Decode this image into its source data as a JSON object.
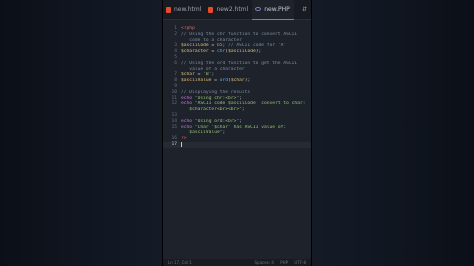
{
  "tabs": [
    {
      "label": "new.html",
      "icon": "html-file-icon",
      "active": false
    },
    {
      "label": "new2.html",
      "icon": "html-file-icon",
      "active": false
    },
    {
      "label": "new.PHP",
      "icon": "php-file-icon",
      "active": true
    }
  ],
  "tab_actions_label": "⇵",
  "code_lines": [
    {
      "num": "1",
      "tokens": [
        {
          "t": "tag",
          "v": "<?php"
        }
      ]
    },
    {
      "num": "2",
      "tokens": [
        {
          "t": "comment",
          "v": "// Using the chr function to convert ASCII"
        }
      ]
    },
    {
      "num": "",
      "tokens": [
        {
          "t": "comment",
          "v": "   code to a character"
        }
      ]
    },
    {
      "num": "3",
      "tokens": [
        {
          "t": "var",
          "v": "$asciiCode"
        },
        {
          "t": "plain",
          "v": " = "
        },
        {
          "t": "num",
          "v": "65"
        },
        {
          "t": "plain",
          "v": "; "
        },
        {
          "t": "comment",
          "v": "// ASCII code for 'A'"
        }
      ]
    },
    {
      "num": "4",
      "tokens": [
        {
          "t": "var",
          "v": "$character"
        },
        {
          "t": "plain",
          "v": " = "
        },
        {
          "t": "fn",
          "v": "chr"
        },
        {
          "t": "plain",
          "v": "("
        },
        {
          "t": "var",
          "v": "$asciiCode"
        },
        {
          "t": "plain",
          "v": ");"
        }
      ]
    },
    {
      "num": "5",
      "tokens": []
    },
    {
      "num": "6",
      "tokens": [
        {
          "t": "comment",
          "v": "// Using the ord function to get the ASCII"
        }
      ]
    },
    {
      "num": "",
      "tokens": [
        {
          "t": "comment",
          "v": "   value of a character"
        }
      ]
    },
    {
      "num": "7",
      "tokens": [
        {
          "t": "var",
          "v": "$char"
        },
        {
          "t": "plain",
          "v": " = "
        },
        {
          "t": "str",
          "v": "'B'"
        },
        {
          "t": "plain",
          "v": ";"
        }
      ]
    },
    {
      "num": "8",
      "tokens": [
        {
          "t": "var",
          "v": "$asciiValue"
        },
        {
          "t": "plain",
          "v": " = "
        },
        {
          "t": "fn",
          "v": "ord"
        },
        {
          "t": "plain",
          "v": "("
        },
        {
          "t": "var",
          "v": "$char"
        },
        {
          "t": "plain",
          "v": ");"
        }
      ]
    },
    {
      "num": "9",
      "tokens": []
    },
    {
      "num": "10",
      "tokens": [
        {
          "t": "comment",
          "v": "// Displaying the results"
        }
      ]
    },
    {
      "num": "11",
      "tokens": [
        {
          "t": "kw",
          "v": "echo"
        },
        {
          "t": "plain",
          "v": " "
        },
        {
          "t": "str",
          "v": "\"Using chr:<br>\""
        },
        {
          "t": "plain",
          "v": ";"
        }
      ]
    },
    {
      "num": "12",
      "tokens": [
        {
          "t": "kw",
          "v": "echo"
        },
        {
          "t": "plain",
          "v": " "
        },
        {
          "t": "str",
          "v": "\"ASCII code $asciiCode  convert to char:"
        }
      ]
    },
    {
      "num": "",
      "tokens": [
        {
          "t": "str",
          "v": "   $character<br><br>\""
        },
        {
          "t": "plain",
          "v": ";"
        }
      ]
    },
    {
      "num": "13",
      "tokens": []
    },
    {
      "num": "14",
      "tokens": [
        {
          "t": "kw",
          "v": "echo"
        },
        {
          "t": "plain",
          "v": " "
        },
        {
          "t": "str",
          "v": "\"Using ord:<br>\""
        },
        {
          "t": "plain",
          "v": ";"
        }
      ]
    },
    {
      "num": "15",
      "tokens": [
        {
          "t": "kw",
          "v": "echo"
        },
        {
          "t": "plain",
          "v": " "
        },
        {
          "t": "str",
          "v": "\"Char '$char' has ASCII value of:"
        }
      ]
    },
    {
      "num": "",
      "tokens": [
        {
          "t": "str",
          "v": "   $asciiValue\""
        },
        {
          "t": "plain",
          "v": ";"
        }
      ]
    },
    {
      "num": "16",
      "tokens": [
        {
          "t": "tag",
          "v": "?>"
        }
      ]
    },
    {
      "num": "17",
      "tokens": [],
      "current": true,
      "cursor": true
    }
  ],
  "status": {
    "position": "Ln 17, Col 1",
    "spaces": "Spaces: 4",
    "language": "PHP",
    "encoding": "UTF-8"
  },
  "colors": {
    "editor_bg": "#1e222a",
    "tag": "#e06c75",
    "comment": "#7f8ea3",
    "variable": "#e5c07b",
    "number": "#d19a66",
    "string": "#98c379",
    "function": "#61afef",
    "keyword": "#c678dd"
  }
}
